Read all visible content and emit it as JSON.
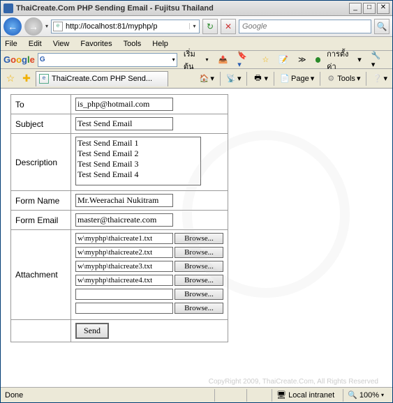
{
  "window": {
    "title": "ThaiCreate.Com PHP Sending Email - Fujitsu Thailand"
  },
  "nav": {
    "url": "http://localhost:81/myphp/p",
    "search_placeholder": "Google"
  },
  "menu": {
    "file": "File",
    "edit": "Edit",
    "view": "View",
    "favorites": "Favorites",
    "tools": "Tools",
    "help": "Help"
  },
  "googlebar": {
    "start": "เริ่มต้น",
    "settings": "การตั้งค่า"
  },
  "tabs": {
    "active": "ThaiCreate.Com PHP Send..."
  },
  "toolbar": {
    "page": "Page",
    "tools": "Tools"
  },
  "form": {
    "labels": {
      "to": "To",
      "subject": "Subject",
      "description": "Description",
      "form_name": "Form Name",
      "form_email": "Form Email",
      "attachment": "Attachment"
    },
    "values": {
      "to": "is_php@hotmail.com",
      "subject": "Test Send Email",
      "description": "Test Send Email 1\nTest Send Email 2\nTest Send Email 3\nTest Send Email 4",
      "form_name": "Mr.Weerachai Nukitram",
      "form_email": "master@thaicreate.com",
      "files": [
        "w\\myphp\\thaicreate1.txt",
        "w\\myphp\\thaicreate2.txt",
        "w\\myphp\\thaicreate3.txt",
        "w\\myphp\\thaicreate4.txt",
        "",
        ""
      ]
    },
    "browse_label": "Browse...",
    "send_label": "Send"
  },
  "footer": {
    "copyright": "CopyRight 2009, ThaiCreate.Com, All Rights Reserved"
  },
  "status": {
    "done": "Done",
    "zone": "Local intranet",
    "zoom": "100%"
  }
}
